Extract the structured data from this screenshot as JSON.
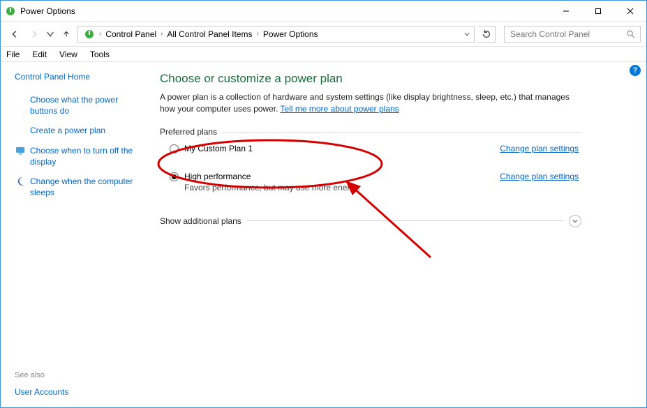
{
  "window": {
    "title": "Power Options"
  },
  "breadcrumb": {
    "items": [
      "Control Panel",
      "All Control Panel Items",
      "Power Options"
    ]
  },
  "search": {
    "placeholder": "Search Control Panel"
  },
  "menu": {
    "file": "File",
    "edit": "Edit",
    "view": "View",
    "tools": "Tools"
  },
  "sidebar": {
    "home": "Control Panel Home",
    "items": [
      {
        "label": "Choose what the power buttons do"
      },
      {
        "label": "Create a power plan"
      },
      {
        "label": "Choose when to turn off the display"
      },
      {
        "label": "Change when the computer sleeps"
      }
    ],
    "see_also_label": "See also",
    "see_also_items": [
      {
        "label": "User Accounts"
      }
    ]
  },
  "main": {
    "heading": "Choose or customize a power plan",
    "description_pre": "A power plan is a collection of hardware and system settings (like display brightness, sleep, etc.) that manages how your computer uses power. ",
    "description_link": "Tell me more about power plans",
    "preferred_label": "Preferred plans",
    "plans": [
      {
        "name": "My Custom Plan 1",
        "desc": "",
        "selected": false,
        "change": "Change plan settings"
      },
      {
        "name": "High performance",
        "desc": "Favors performance, but may use more energy.",
        "selected": true,
        "change": "Change plan settings"
      }
    ],
    "additional_label": "Show additional plans"
  },
  "help_badge": "?"
}
